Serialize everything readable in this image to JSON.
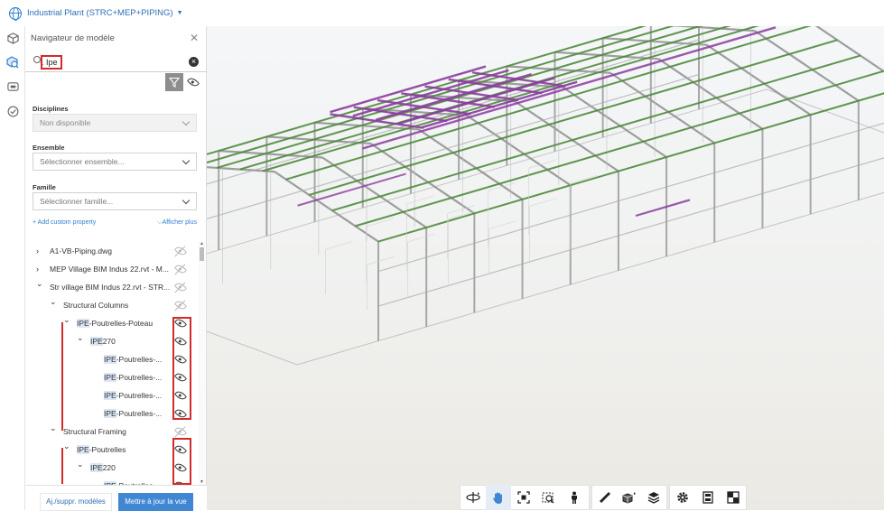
{
  "header": {
    "project_title": "Industrial Plant (STRC+MEP+PIPING)"
  },
  "rail": {
    "icons": [
      "cube-icon",
      "model-browser-icon",
      "comments-icon",
      "check-icon"
    ]
  },
  "panel": {
    "title": "Navigateur de modèle",
    "search_value": "Ipe",
    "disciplines_label": "Disciplines",
    "disciplines_value": "Non disponible",
    "ensemble_label": "Ensemble",
    "ensemble_placeholder": "Sélectionner ensemble...",
    "famille_label": "Famille",
    "famille_placeholder": "Sélectionner famille...",
    "add_property": "+ Add custom property",
    "show_more": "Afficher plus",
    "tree": [
      {
        "arrow": "›",
        "match": "",
        "text": "A1-VB-Piping.dwg",
        "eye": "off"
      },
      {
        "arrow": "›",
        "match": "",
        "text": "MEP Village BIM Indus 22.rvt - M...",
        "eye": "off"
      },
      {
        "arrow": "⌄",
        "match": "",
        "text": "Str village BIM Indus 22.rvt - STR...",
        "eye": "off"
      },
      {
        "arrow": "⌄",
        "match": "",
        "text": "Structural Columns",
        "eye": "off"
      },
      {
        "arrow": "⌄",
        "match": "IPE",
        "text": "-Poutrelles-Poteau",
        "eye": "on"
      },
      {
        "arrow": "⌄",
        "match": "IPE",
        "text": "270",
        "eye": "on"
      },
      {
        "arrow": "",
        "match": "IPE",
        "text": "-Poutrelles-...",
        "eye": "on"
      },
      {
        "arrow": "",
        "match": "IPE",
        "text": "-Poutrelles-...",
        "eye": "on"
      },
      {
        "arrow": "",
        "match": "IPE",
        "text": "-Poutrelles-...",
        "eye": "on"
      },
      {
        "arrow": "",
        "match": "IPE",
        "text": "-Poutrelles-...",
        "eye": "on"
      },
      {
        "arrow": "⌄",
        "match": "",
        "text": "Structural Framing",
        "eye": "off"
      },
      {
        "arrow": "⌄",
        "match": "IPE",
        "text": "-Poutrelles",
        "eye": "on"
      },
      {
        "arrow": "⌄",
        "match": "IPE",
        "text": "220",
        "eye": "on"
      },
      {
        "arrow": "",
        "match": "IPE",
        "text": "-Poutrelles",
        "eye": "on"
      }
    ],
    "btn_models": "Aj./suppr. modèles",
    "btn_update": "Mettre à jour la vue"
  },
  "toolbar": {
    "group1": [
      "orbit-icon",
      "pan-hand-icon",
      "fit-view-icon",
      "zoom-window-icon",
      "first-person-icon"
    ],
    "group2": [
      "measure-icon",
      "section-box-icon",
      "layers-icon"
    ],
    "group3": [
      "settings-gear-icon",
      "properties-icon",
      "fullscreen-icon"
    ]
  },
  "colors": {
    "accent": "#2f7fd1",
    "highlight_red": "#d42a2a",
    "beam_green": "#4f8a3c",
    "beam_purple": "#8a3d9e"
  }
}
